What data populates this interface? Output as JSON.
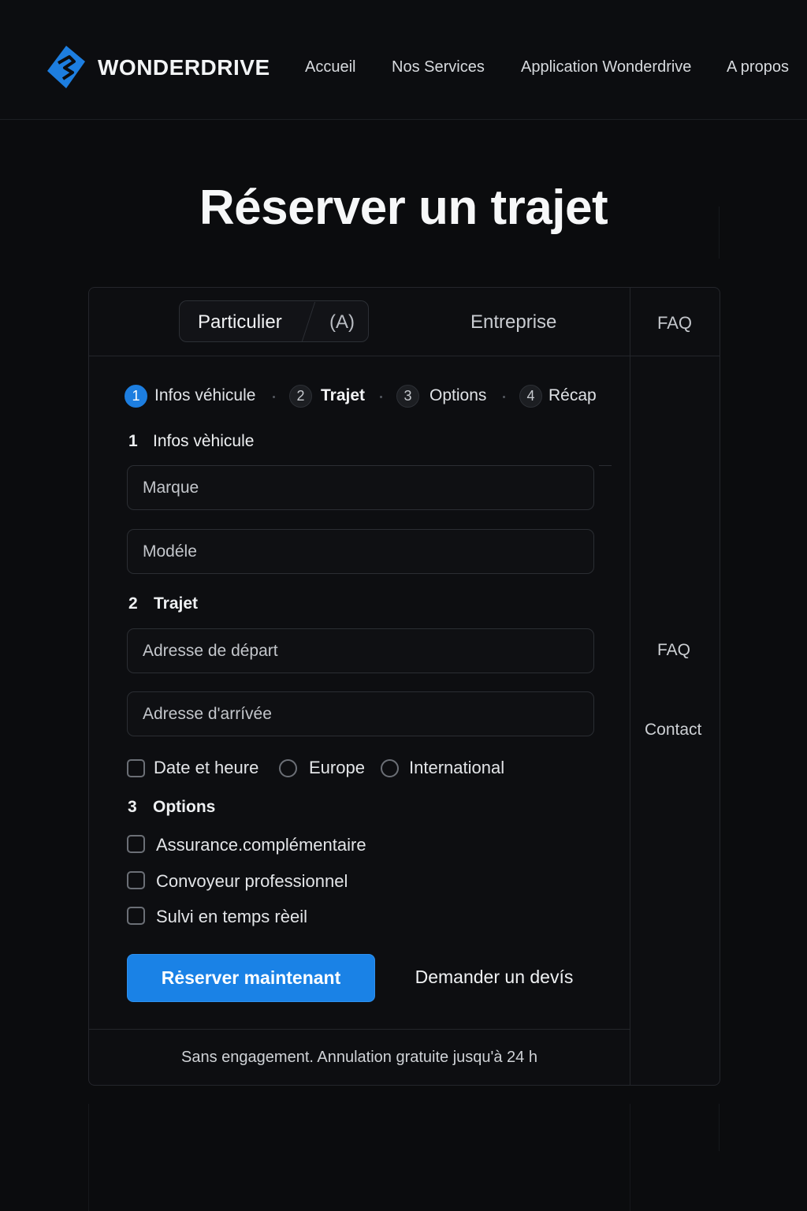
{
  "header": {
    "brand": "WONDERDRIVE",
    "nav": [
      "Accueil",
      "Nos Services",
      "Application Wonderdrive",
      "A propos"
    ]
  },
  "page": {
    "title": "Réserver un trajet"
  },
  "tabs": {
    "particulier": "Particulier",
    "particulier_badge": "(A)",
    "entreprise": "Entreprise",
    "faq": "FAQ"
  },
  "steps": [
    {
      "num": "1",
      "label": "Infos véhicule",
      "active": true
    },
    {
      "num": "2",
      "label": "Trajet"
    },
    {
      "num": "3",
      "label": "Options"
    },
    {
      "num": "4",
      "label": "Récap"
    }
  ],
  "sections": {
    "vehicle": {
      "num": "1",
      "title": "Infos vèhicule"
    },
    "trip": {
      "num": "2",
      "title": "Trajet"
    },
    "options": {
      "num": "3",
      "title": "Options"
    }
  },
  "fields": {
    "brand": {
      "placeholder": "Marque"
    },
    "model": {
      "placeholder": "Modéle"
    },
    "departure": {
      "placeholder": "Adresse de départ"
    },
    "arrival": {
      "placeholder": "Adresse d'arrívée"
    }
  },
  "trip_choices": {
    "date": "Date et heure",
    "europe": "Europe",
    "international": "International"
  },
  "options": [
    "Assurance.complémentaire",
    "Convoyeur professionnel",
    "Sulvi en temps rèeil"
  ],
  "actions": {
    "primary": "Rėserver maintenant",
    "secondary": "Demander un devís"
  },
  "footnote": "Sans engagement. Annulation gratuite jusqu'à 24 h",
  "sidebar": {
    "faq": "FAQ",
    "contact": "Contact"
  },
  "colors": {
    "accent": "#1a82e6",
    "background": "#0b0c0e"
  }
}
